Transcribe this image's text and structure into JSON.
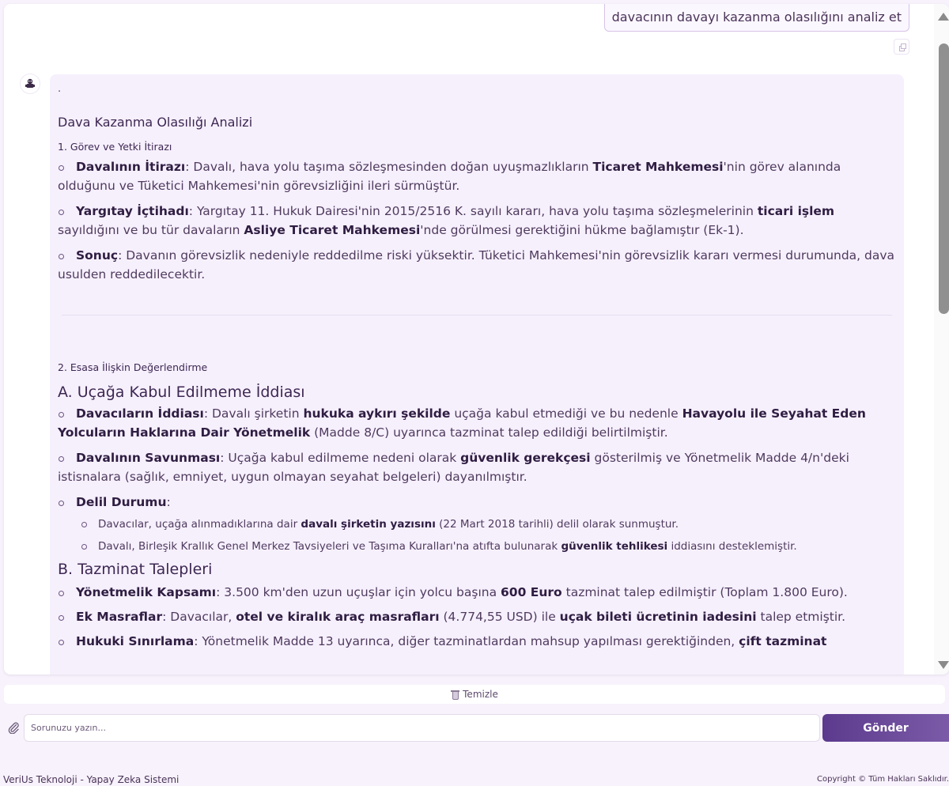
{
  "user_message": "davacının davayı kazanma olasılığını analiz et",
  "response": {
    "leading_dot": ".",
    "title": "Dava Kazanma Olasılığı Analizi",
    "section1": {
      "heading": "1. Görev ve Yetki İtirazı",
      "items": [
        {
          "segments": [
            {
              "t": "Davalının İtirazı",
              "b": true
            },
            {
              "t": ": Davalı, hava yolu taşıma sözleşmesinden doğan uyuşmazlıkların "
            },
            {
              "t": "Ticaret Mahkemesi",
              "b": true
            },
            {
              "t": "'nin görev alanında olduğunu ve Tüketici Mahkemesi'nin görevsizliğini ileri sürmüştür."
            }
          ]
        },
        {
          "segments": [
            {
              "t": "Yargıtay İçtihadı",
              "b": true
            },
            {
              "t": ": Yargıtay 11. Hukuk Dairesi'nin 2015/2516 K. sayılı kararı, hava yolu taşıma sözleşmelerinin "
            },
            {
              "t": "ticari işlem",
              "b": true
            },
            {
              "t": " sayıldığını ve bu tür davaların "
            },
            {
              "t": "Asliye Ticaret Mahkemesi",
              "b": true
            },
            {
              "t": "'nde görülmesi gerektiğini hükme bağlamıştır (Ek-1)."
            }
          ]
        },
        {
          "segments": [
            {
              "t": "Sonuç",
              "b": true
            },
            {
              "t": ": Davanın görevsizlik nedeniyle reddedilme riski yüksektir. Tüketici Mahkemesi'nin görevsizlik kararı vermesi durumunda, dava usulden reddedilecektir."
            }
          ]
        }
      ]
    },
    "section2": {
      "heading": "2. Esasa İlişkin Değerlendirme",
      "subA": {
        "heading": "A. Uçağa Kabul Edilmeme İddiası",
        "items": [
          {
            "segments": [
              {
                "t": "Davacıların İddiası",
                "b": true
              },
              {
                "t": ": Davalı şirketin "
              },
              {
                "t": "hukuka aykırı şekilde",
                "b": true
              },
              {
                "t": " uçağa kabul etmediği ve bu nedenle "
              },
              {
                "t": "Havayolu ile Seyahat Eden Yolcuların Haklarına Dair Yönetmelik",
                "b": true
              },
              {
                "t": " (Madde 8/C) uyarınca tazminat talep edildiği belirtilmiştir."
              }
            ]
          },
          {
            "segments": [
              {
                "t": "Davalının Savunması",
                "b": true
              },
              {
                "t": ": Uçağa kabul edilmeme nedeni olarak "
              },
              {
                "t": "güvenlik gerekçesi",
                "b": true
              },
              {
                "t": " gösterilmiş ve Yönetmelik Madde 4/n'deki istisnalara (sağlık, emniyet, uygun olmayan seyahat belgeleri) dayanılmıştır."
              }
            ]
          },
          {
            "segments": [
              {
                "t": "Delil Durumu",
                "b": true
              },
              {
                "t": ":"
              }
            ]
          }
        ],
        "sub_items": [
          {
            "segments": [
              {
                "t": "Davacılar, uçağa alınmadıklarına dair "
              },
              {
                "t": "davalı şirketin yazısını",
                "b": true
              },
              {
                "t": " (22 Mart 2018 tarihli) delil olarak sunmuştur."
              }
            ]
          },
          {
            "segments": [
              {
                "t": "Davalı, Birleşik Krallık Genel Merkez Tavsiyeleri ve Taşıma Kuralları'na atıfta bulunarak "
              },
              {
                "t": "güvenlik tehlikesi",
                "b": true
              },
              {
                "t": " iddiasını desteklemiştir."
              }
            ]
          }
        ]
      },
      "subB": {
        "heading": "B. Tazminat Talepleri",
        "items": [
          {
            "segments": [
              {
                "t": "Yönetmelik Kapsamı",
                "b": true
              },
              {
                "t": ": 3.500 km'den uzun uçuşlar için yolcu başına "
              },
              {
                "t": "600 Euro",
                "b": true
              },
              {
                "t": " tazminat talep edilmiştir (Toplam 1.800 Euro)."
              }
            ]
          },
          {
            "segments": [
              {
                "t": "Ek Masraflar",
                "b": true
              },
              {
                "t": ": Davacılar, "
              },
              {
                "t": "otel ve kiralık araç masrafları",
                "b": true
              },
              {
                "t": " (4.774,55 USD) ile "
              },
              {
                "t": "uçak bileti ücretinin iadesini",
                "b": true
              },
              {
                "t": " talep etmiştir."
              }
            ]
          },
          {
            "segments": [
              {
                "t": "Hukuki Sınırlama",
                "b": true
              },
              {
                "t": ": Yönetmelik Madde 13 uyarınca, diğer tazminatlardan mahsup yapılması gerektiğinden, "
              },
              {
                "t": "çift tazminat",
                "b": true
              }
            ]
          }
        ]
      }
    }
  },
  "clear_button": "Temizle",
  "input": {
    "placeholder": "Sorunuzu yazın...",
    "value": ""
  },
  "send_button": "Gönder",
  "footer": {
    "left": "VeriUs Teknoloji - Yapay Zeka Sistemi",
    "right": "Copyright © Tüm Hakları Saklıdır."
  },
  "icons": {
    "attach": "paperclip-icon",
    "trash": "trash-icon",
    "copy": "copy-icon",
    "avatar": "bot-avatar-icon"
  }
}
